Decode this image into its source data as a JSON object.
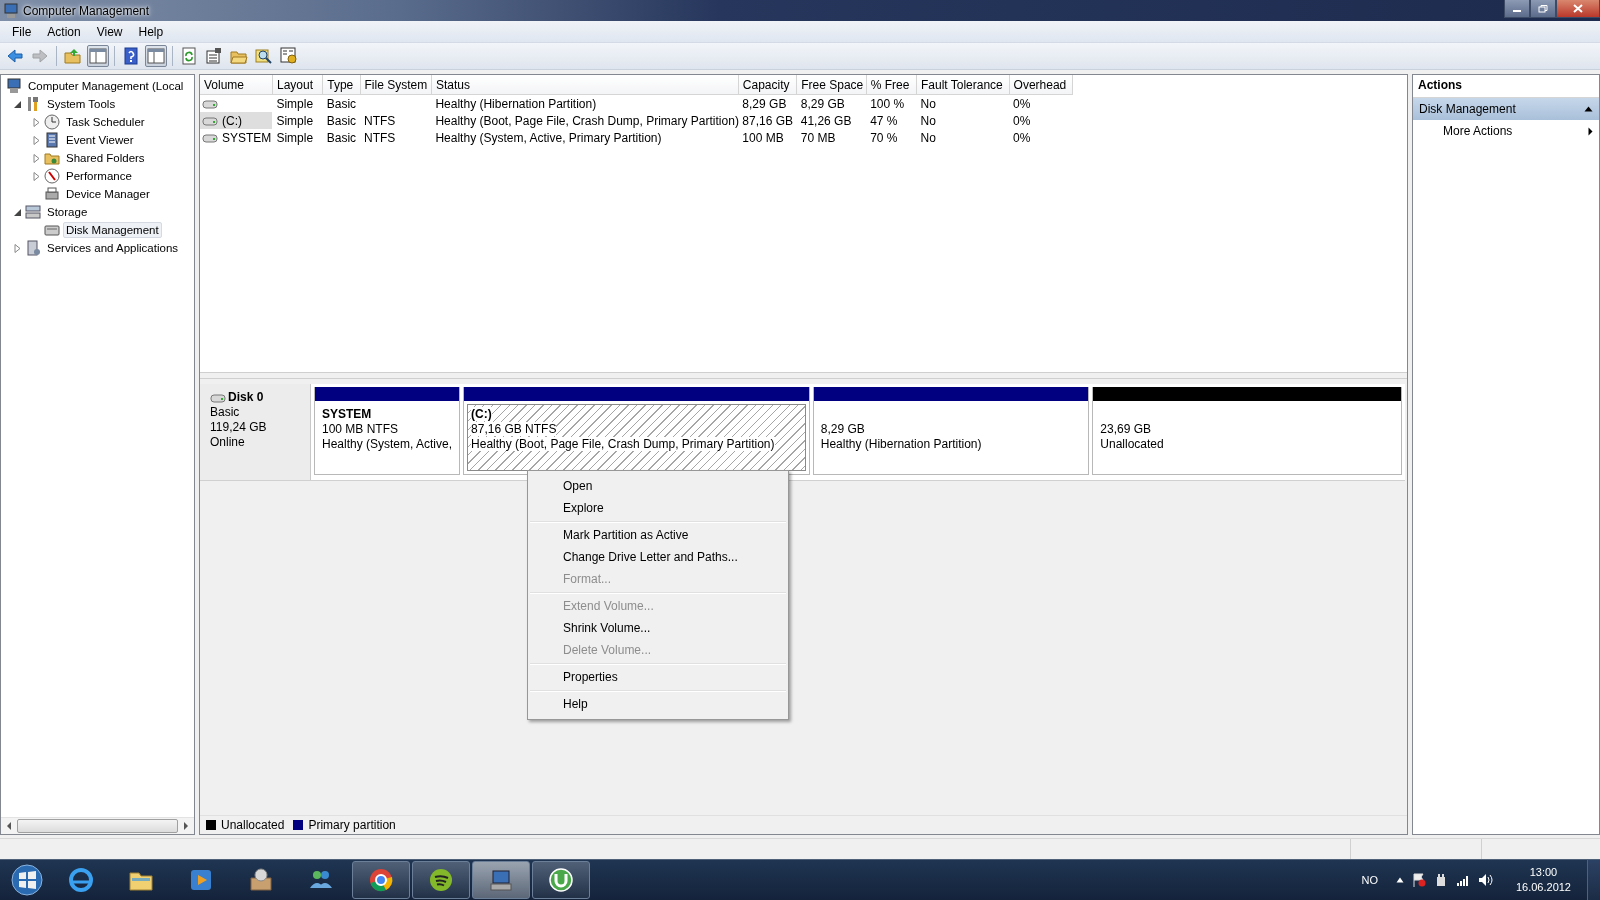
{
  "window": {
    "title": "Computer Management"
  },
  "menu": [
    "File",
    "Action",
    "View",
    "Help"
  ],
  "toolbar": [
    {
      "kind": "back",
      "disabled": false,
      "pressed": false
    },
    {
      "kind": "forward",
      "disabled": true,
      "pressed": false
    },
    {
      "kind": "sep"
    },
    {
      "kind": "up",
      "disabled": false,
      "pressed": false
    },
    {
      "kind": "pane",
      "disabled": false,
      "pressed": true
    },
    {
      "kind": "sep"
    },
    {
      "kind": "help",
      "disabled": false,
      "pressed": false
    },
    {
      "kind": "pane",
      "disabled": false,
      "pressed": true
    },
    {
      "kind": "sep"
    },
    {
      "kind": "refresh",
      "disabled": false,
      "pressed": false
    },
    {
      "kind": "props",
      "disabled": false,
      "pressed": false
    },
    {
      "kind": "folder",
      "disabled": false,
      "pressed": false
    },
    {
      "kind": "find",
      "disabled": false,
      "pressed": false
    },
    {
      "kind": "settings",
      "disabled": false,
      "pressed": false
    }
  ],
  "tree": [
    {
      "label": "Computer Management (Local",
      "selected": false,
      "children": [
        {
          "label": "System Tools",
          "selected": false,
          "expanded": true,
          "children": [
            {
              "label": "Task Scheduler",
              "selected": false,
              "expanded": false
            },
            {
              "label": "Event Viewer",
              "selected": false,
              "expanded": false
            },
            {
              "label": "Shared Folders",
              "selected": false,
              "expanded": false
            },
            {
              "label": "Performance",
              "selected": false,
              "expanded": false
            },
            {
              "label": "Device Manager",
              "selected": false
            }
          ]
        },
        {
          "label": "Storage",
          "selected": false,
          "expanded": true,
          "children": [
            {
              "label": "Disk Management",
              "selected": true
            }
          ]
        },
        {
          "label": "Services and Applications",
          "selected": false,
          "expanded": false
        }
      ]
    }
  ],
  "volumes": {
    "columns": [
      "Volume",
      "Layout",
      "Type",
      "File System",
      "Status",
      "Capacity",
      "Free Space",
      "% Free",
      "Fault Tolerance",
      "Overhead"
    ],
    "rows": [
      {
        "selected": false,
        "cells": [
          "",
          "Simple",
          "Basic",
          "",
          "Healthy (Hibernation Partition)",
          "8,29 GB",
          "8,29 GB",
          "100 %",
          "No",
          "0%"
        ]
      },
      {
        "selected": true,
        "cells": [
          "(C:)",
          "Simple",
          "Basic",
          "NTFS",
          "Healthy (Boot, Page File, Crash Dump, Primary Partition)",
          "87,16 GB",
          "41,26 GB",
          "47 %",
          "No",
          "0%"
        ]
      },
      {
        "selected": false,
        "cells": [
          "SYSTEM",
          "Simple",
          "Basic",
          "NTFS",
          "Healthy (System, Active, Primary Partition)",
          "100 MB",
          "70 MB",
          "70 %",
          "No",
          "0%"
        ]
      }
    ]
  },
  "disks": [
    {
      "name": "Disk 0",
      "type": "Basic",
      "size": "119,24 GB",
      "status": "Online",
      "partitions": [
        {
          "kind": "primary",
          "name": "SYSTEM",
          "detail": "100 MB NTFS",
          "status": "Healthy (System, Active,",
          "selected": false
        },
        {
          "kind": "primary",
          "name": "(C:)",
          "detail": "87,16 GB NTFS",
          "status": "Healthy (Boot, Page File, Crash Dump, Primary Partition)",
          "selected": true
        },
        {
          "kind": "primary",
          "detail": "8,29 GB",
          "status": "Healthy (Hibernation Partition)",
          "selected": false
        },
        {
          "kind": "unallocated",
          "detail": "23,69 GB",
          "status": "Unallocated",
          "selected": false
        }
      ]
    }
  ],
  "legend": [
    {
      "label": "Unallocated",
      "color": "#000000"
    },
    {
      "label": "Primary partition",
      "color": "#000080"
    }
  ],
  "context_menu": [
    [
      {
        "label": "Open",
        "disabled": false
      },
      {
        "label": "Explore",
        "disabled": false
      }
    ],
    [
      {
        "label": "Mark Partition as Active",
        "disabled": false
      },
      {
        "label": "Change Drive Letter and Paths...",
        "disabled": false
      },
      {
        "label": "Format...",
        "disabled": true
      }
    ],
    [
      {
        "label": "Extend Volume...",
        "disabled": true
      },
      {
        "label": "Shrink Volume...",
        "disabled": false
      },
      {
        "label": "Delete Volume...",
        "disabled": true
      }
    ],
    [
      {
        "label": "Properties",
        "disabled": false
      }
    ],
    [
      {
        "label": "Help",
        "disabled": false
      }
    ]
  ],
  "actions": {
    "title": "Actions",
    "sections": [
      {
        "title": "Disk Management",
        "expanded": true,
        "items": [
          {
            "label": "More Actions",
            "submenu": true
          }
        ]
      }
    ]
  },
  "taskbar": {
    "buttons": [
      {
        "kind": "ie",
        "open": false,
        "active": false
      },
      {
        "kind": "explorer",
        "open": false,
        "active": false
      },
      {
        "kind": "media",
        "open": false,
        "active": false
      },
      {
        "kind": "box",
        "open": false,
        "active": false
      },
      {
        "kind": "people",
        "open": false,
        "active": false
      },
      {
        "kind": "chrome",
        "open": true,
        "active": false
      },
      {
        "kind": "spotify",
        "open": true,
        "active": false
      },
      {
        "kind": "compmgmt",
        "open": true,
        "active": true
      },
      {
        "kind": "torrent",
        "open": true,
        "active": false
      }
    ],
    "language": "NO",
    "time": "13:00",
    "date": "16.06.2012"
  }
}
